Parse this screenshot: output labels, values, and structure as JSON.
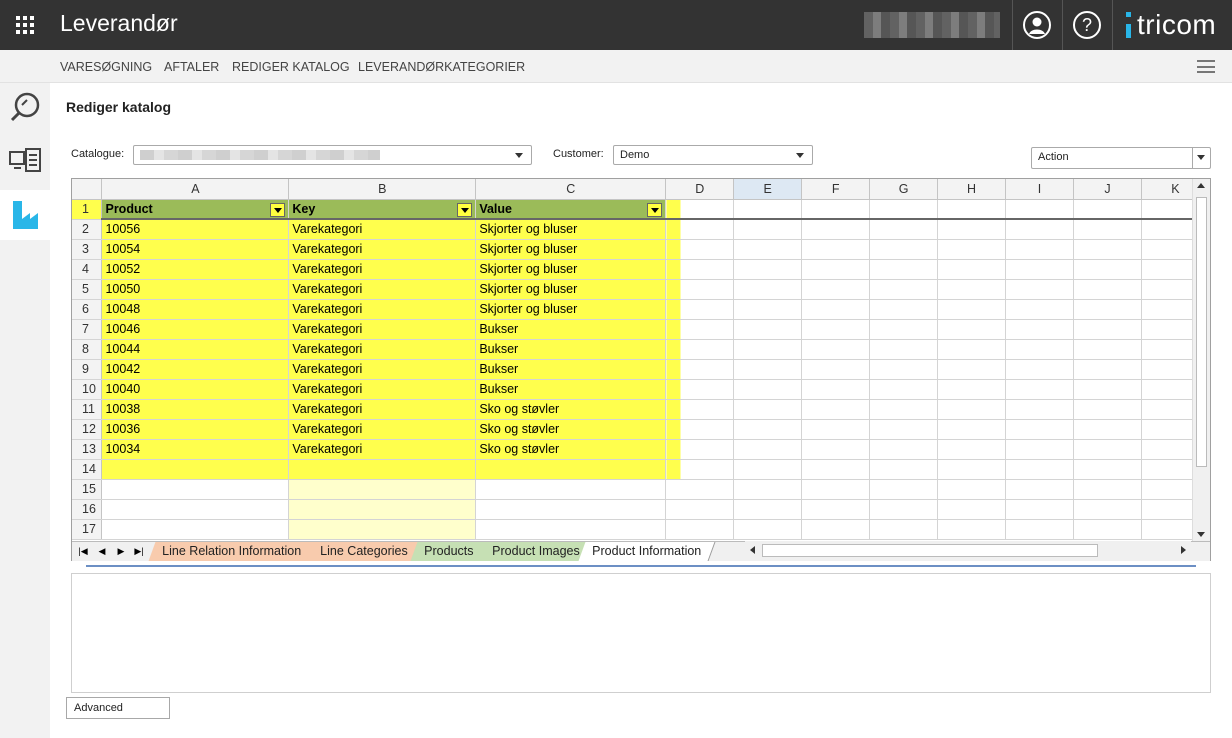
{
  "app": {
    "title": "Leverandør",
    "brand": "tricom"
  },
  "top_icons": {
    "help": "?"
  },
  "nav": {
    "items": [
      "VARESØGNING",
      "AFTALER",
      "REDIGER KATALOG",
      "LEVERANDØRKATEGORIER"
    ]
  },
  "page": {
    "title": "Rediger katalog"
  },
  "filters": {
    "catalogue_label": "Catalogue:",
    "customer_label": "Customer:",
    "customer_value": "Demo",
    "action_label": "Action"
  },
  "sheet": {
    "columns": [
      "A",
      "B",
      "C",
      "D",
      "E",
      "F",
      "G",
      "H",
      "I",
      "J",
      "K"
    ],
    "selected_column": "E",
    "header_row": [
      "Product",
      "Key",
      "Value"
    ],
    "rows": [
      [
        "10056",
        "Varekategori",
        "Skjorter og bluser"
      ],
      [
        "10054",
        "Varekategori",
        "Skjorter og bluser"
      ],
      [
        "10052",
        "Varekategori",
        "Skjorter og bluser"
      ],
      [
        "10050",
        "Varekategori",
        "Skjorter og bluser"
      ],
      [
        "10048",
        "Varekategori",
        "Skjorter og bluser"
      ],
      [
        "10046",
        "Varekategori",
        "Bukser"
      ],
      [
        "10044",
        "Varekategori",
        "Bukser"
      ],
      [
        "10042",
        "Varekategori",
        "Bukser"
      ],
      [
        "10040",
        "Varekategori",
        "Bukser"
      ],
      [
        "10038",
        "Varekategori",
        "Sko og støvler"
      ],
      [
        "10036",
        "Varekategori",
        "Sko og støvler"
      ],
      [
        "10034",
        "Varekategori",
        "Sko og støvler"
      ]
    ],
    "row_numbers": [
      "1",
      "2",
      "3",
      "4",
      "5",
      "6",
      "7",
      "8",
      "9",
      "10",
      "11",
      "12",
      "13",
      "14",
      "15",
      "16",
      "17"
    ],
    "tabs": [
      {
        "label": "Line Relation Information",
        "color": "#f8cbad"
      },
      {
        "label": "Line Categories",
        "color": "#f8cbad"
      },
      {
        "label": "Products",
        "color": "#c6e0b4"
      },
      {
        "label": "Product Images",
        "color": "#c6e0b4"
      },
      {
        "label": "Product Information",
        "color": "#ffffff"
      }
    ]
  },
  "colors": {
    "header_fill": "#9bbb59",
    "yellow_fill": "#ffff4d",
    "accent": "#29b6e8"
  },
  "buttons": {
    "advanced": "Advanced"
  }
}
